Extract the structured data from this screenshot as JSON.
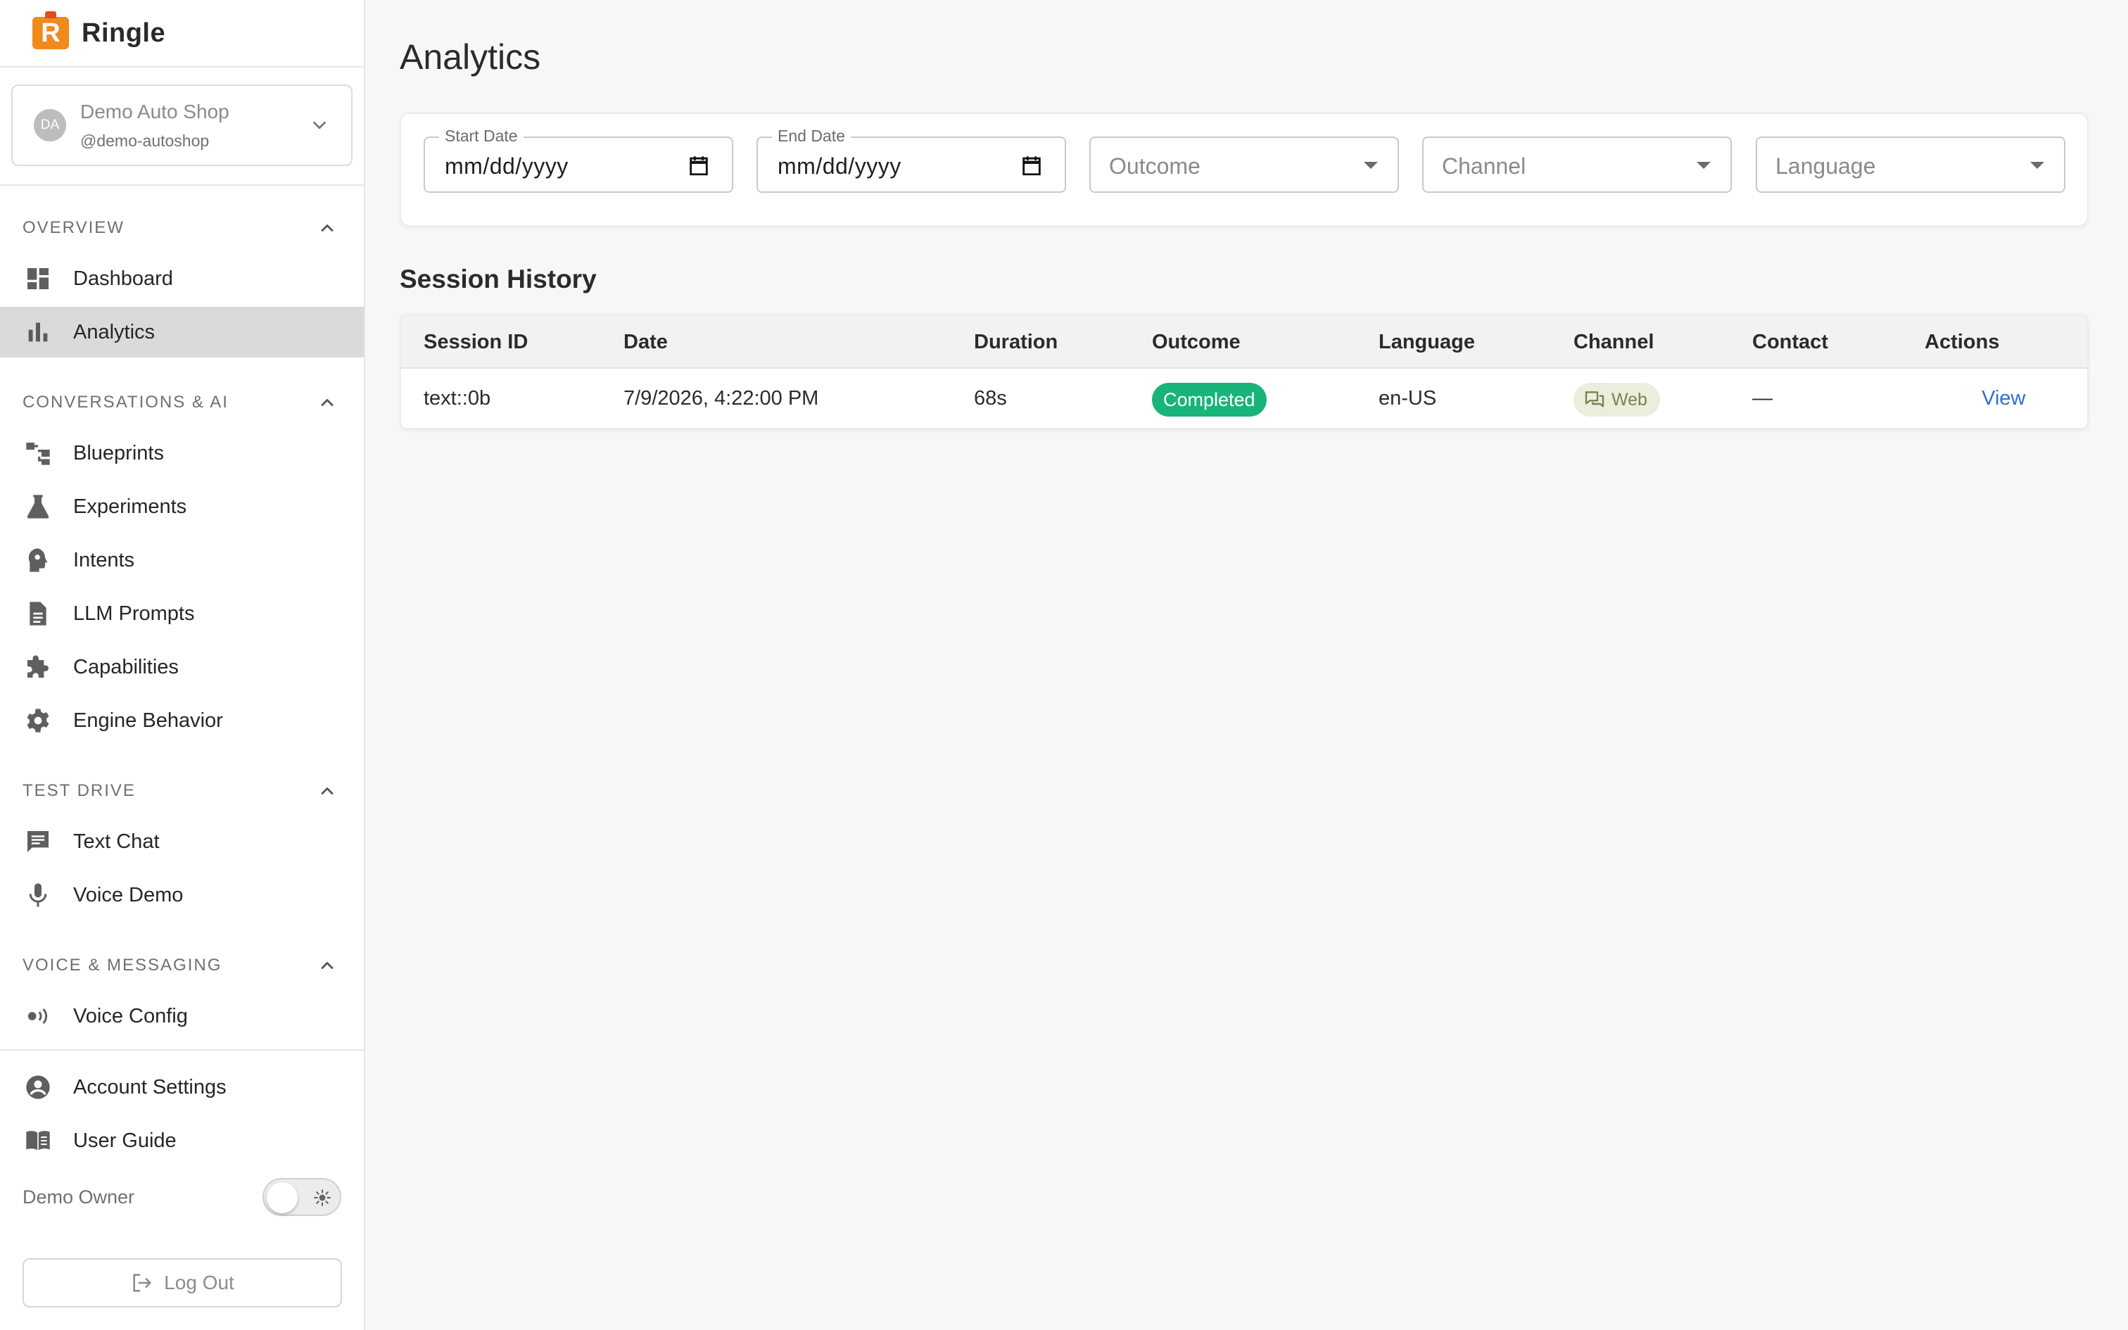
{
  "brand": {
    "logo_letter": "R",
    "name": "Ringle"
  },
  "org": {
    "avatar_initials": "DA",
    "name": "Demo Auto Shop",
    "handle": "@demo-autoshop"
  },
  "nav": {
    "sections": [
      {
        "title": "OVERVIEW",
        "items": [
          {
            "label": "Dashboard",
            "icon": "dashboard-icon"
          },
          {
            "label": "Analytics",
            "icon": "bar-chart-icon",
            "active": true
          }
        ]
      },
      {
        "title": "CONVERSATIONS & AI",
        "items": [
          {
            "label": "Blueprints",
            "icon": "blueprint-icon"
          },
          {
            "label": "Experiments",
            "icon": "flask-icon"
          },
          {
            "label": "Intents",
            "icon": "brain-icon"
          },
          {
            "label": "LLM Prompts",
            "icon": "document-icon"
          },
          {
            "label": "Capabilities",
            "icon": "puzzle-icon"
          },
          {
            "label": "Engine Behavior",
            "icon": "gear-icon"
          }
        ]
      },
      {
        "title": "TEST DRIVE",
        "items": [
          {
            "label": "Text Chat",
            "icon": "chat-icon"
          },
          {
            "label": "Voice Demo",
            "icon": "microphone-icon"
          }
        ]
      },
      {
        "title": "VOICE & MESSAGING",
        "items": [
          {
            "label": "Voice Config",
            "icon": "voice-config-icon"
          }
        ]
      }
    ]
  },
  "footer": {
    "account_settings": "Account Settings",
    "user_guide": "User Guide",
    "owner_name": "Demo Owner",
    "logout": "Log Out"
  },
  "page": {
    "title": "Analytics"
  },
  "filters": {
    "start_date": {
      "label": "Start Date",
      "value": "mm/dd/yyyy"
    },
    "end_date": {
      "label": "End Date",
      "value": "mm/dd/yyyy"
    },
    "outcome": {
      "placeholder": "Outcome"
    },
    "channel": {
      "placeholder": "Channel"
    },
    "language": {
      "placeholder": "Language"
    }
  },
  "sessions": {
    "title": "Session History",
    "columns": [
      "Session ID",
      "Date",
      "Duration",
      "Outcome",
      "Language",
      "Channel",
      "Contact",
      "Actions"
    ],
    "rows": [
      {
        "session_id": "text::0b",
        "date": "7/9/2026, 4:22:00 PM",
        "duration": "68s",
        "outcome": "Completed",
        "language": "en-US",
        "channel": "Web",
        "contact": "—",
        "action": "View"
      }
    ]
  },
  "colors": {
    "accent": "#f08a1c",
    "completed_badge": "#18b47a",
    "channel_badge": "#eceedd",
    "link": "#2f6fcf",
    "active_nav": "#dadada"
  }
}
